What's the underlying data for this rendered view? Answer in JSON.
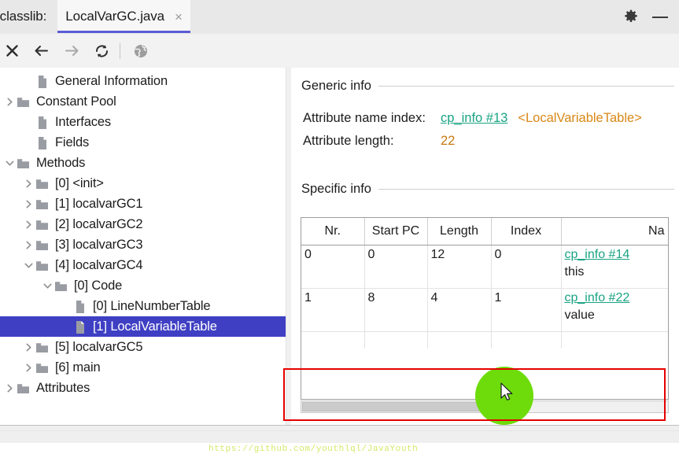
{
  "window": {
    "app_prefix": "jclasslib:",
    "tab_label": "LocalVarGC.java",
    "tab_close": "×",
    "settings_icon": "gear-icon",
    "minimize_icon": "minimize-icon"
  },
  "toolbar": {
    "buttons": [
      {
        "name": "close-icon",
        "glyph": "✕",
        "enabled": true
      },
      {
        "name": "back-arrow-icon",
        "glyph": "←",
        "enabled": true
      },
      {
        "name": "forward-arrow-icon",
        "glyph": "→",
        "enabled": false
      },
      {
        "name": "reload-icon",
        "glyph": "↻",
        "enabled": true
      },
      {
        "name": "globe-icon",
        "glyph": "●",
        "enabled": false
      }
    ]
  },
  "tree": {
    "nodes": [
      {
        "label": "General Information",
        "indent": 1,
        "icon": "file-icon",
        "twisty": "none",
        "selected": false
      },
      {
        "label": "Constant Pool",
        "indent": 0,
        "icon": "folder-icon",
        "twisty": "collapsed",
        "selected": false
      },
      {
        "label": "Interfaces",
        "indent": 1,
        "icon": "file-icon",
        "twisty": "none",
        "selected": false
      },
      {
        "label": "Fields",
        "indent": 1,
        "icon": "file-icon",
        "twisty": "none",
        "selected": false
      },
      {
        "label": "Methods",
        "indent": 0,
        "icon": "folder-icon",
        "twisty": "expanded",
        "selected": false
      },
      {
        "label": "[0] <init>",
        "indent": 1,
        "icon": "folder-icon",
        "twisty": "collapsed",
        "selected": false
      },
      {
        "label": "[1] localvarGC1",
        "indent": 1,
        "icon": "folder-icon",
        "twisty": "collapsed",
        "selected": false
      },
      {
        "label": "[2] localvarGC2",
        "indent": 1,
        "icon": "folder-icon",
        "twisty": "collapsed",
        "selected": false
      },
      {
        "label": "[3] localvarGC3",
        "indent": 1,
        "icon": "folder-icon",
        "twisty": "collapsed",
        "selected": false
      },
      {
        "label": "[4] localvarGC4",
        "indent": 1,
        "icon": "folder-icon",
        "twisty": "expanded",
        "selected": false
      },
      {
        "label": "[0] Code",
        "indent": 2,
        "icon": "folder-icon",
        "twisty": "expanded",
        "selected": false
      },
      {
        "label": "[0] LineNumberTable",
        "indent": 3,
        "icon": "file-icon",
        "twisty": "none",
        "selected": false
      },
      {
        "label": "[1] LocalVariableTable",
        "indent": 3,
        "icon": "file-icon",
        "twisty": "none",
        "selected": true
      },
      {
        "label": "[5] localvarGC5",
        "indent": 1,
        "icon": "folder-icon",
        "twisty": "collapsed",
        "selected": false
      },
      {
        "label": "[6] main",
        "indent": 1,
        "icon": "folder-icon",
        "twisty": "collapsed",
        "selected": false
      },
      {
        "label": "Attributes",
        "indent": 0,
        "icon": "folder-icon",
        "twisty": "collapsed",
        "selected": false
      }
    ]
  },
  "detail": {
    "generic_title": "Generic info",
    "attribute_name_index_label": "Attribute name index:",
    "attribute_name_index_link": "cp_info #13",
    "attribute_name_index_desc": "<LocalVariableTable>",
    "attribute_length_label": "Attribute length:",
    "attribute_length_value": "22",
    "specific_title": "Specific info",
    "table": {
      "columns": [
        "Nr.",
        "Start PC",
        "Length",
        "Index",
        "Na"
      ],
      "rows": [
        {
          "nr": "0",
          "start_pc": "0",
          "length": "12",
          "index": "0",
          "name_link": "cp_info #14",
          "name_value": "this"
        },
        {
          "nr": "1",
          "start_pc": "8",
          "length": "4",
          "index": "1",
          "name_link": "cp_info #22",
          "name_value": "value"
        }
      ]
    }
  },
  "watermark": {
    "text": "https://github.com/youthlql/JavaYouth"
  },
  "annotations": {
    "highlight_color": "#6ddc0a",
    "callout_color": "#e60000",
    "cursor_icon": "mouse-pointer-icon"
  },
  "colors": {
    "selection": "#3f3fc4",
    "link": "#19a383",
    "value": "#c87a10",
    "tab_accent": "#5b5bd6"
  }
}
